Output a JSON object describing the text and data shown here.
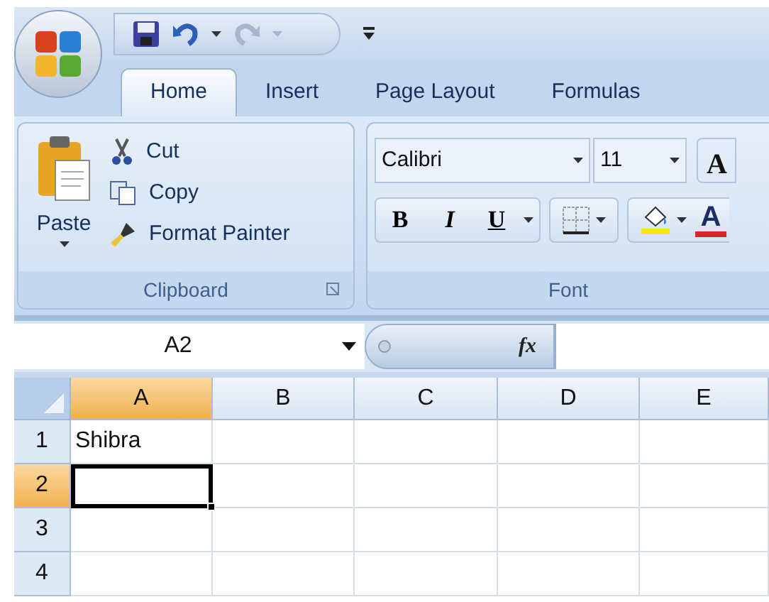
{
  "tabs": [
    {
      "label": "Home",
      "selected": true
    },
    {
      "label": "Insert",
      "selected": false
    },
    {
      "label": "Page Layout",
      "selected": false
    },
    {
      "label": "Formulas",
      "selected": false
    }
  ],
  "clipboard": {
    "paste": "Paste",
    "cut": "Cut",
    "copy": "Copy",
    "format_painter": "Format Painter",
    "label": "Clipboard"
  },
  "font": {
    "name": "Calibri",
    "size": "11",
    "grow": "A",
    "bold": "B",
    "italic": "I",
    "underline": "U",
    "font_color": "A",
    "label": "Font"
  },
  "name_box": "A2",
  "fx": "fx",
  "grid": {
    "columns": [
      {
        "label": "A",
        "selected": true
      },
      {
        "label": "B",
        "selected": false
      },
      {
        "label": "C",
        "selected": false
      },
      {
        "label": "D",
        "selected": false
      },
      {
        "label": "E",
        "selected": false
      }
    ],
    "rows": [
      {
        "label": "1",
        "selected": false,
        "cells": [
          "Shibra"
        ]
      },
      {
        "label": "2",
        "selected": true
      },
      {
        "label": "3",
        "selected": false
      },
      {
        "label": "4",
        "selected": false
      }
    ]
  }
}
